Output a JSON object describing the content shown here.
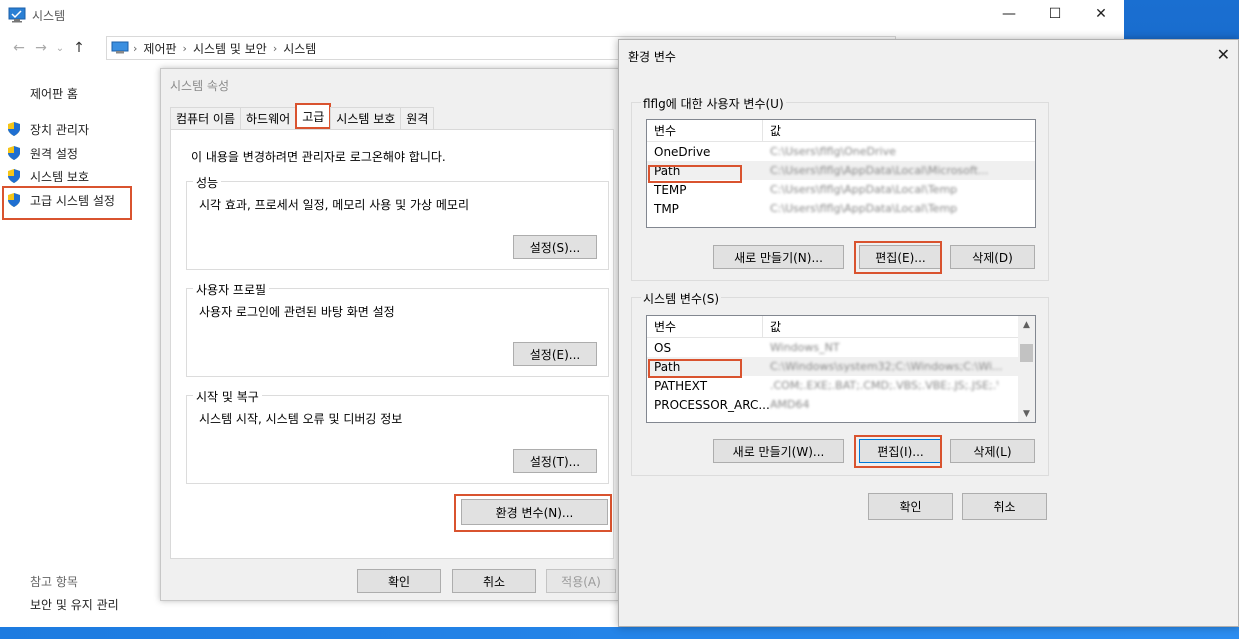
{
  "window": {
    "title": "시스템",
    "min_glyph": "—",
    "max_glyph": "☐",
    "close_glyph": "✕"
  },
  "address": {
    "back_glyph": "←",
    "forward_glyph": "→",
    "dropdown_glyph": "⌄",
    "up_glyph": "↑",
    "breadcrumbs": [
      "제어판",
      "시스템 및 보안",
      "시스템"
    ],
    "sep": "›"
  },
  "left_nav": {
    "home": "제어판 홈",
    "items": [
      "장치 관리자",
      "원격 설정",
      "시스템 보호",
      "고급 시스템 설정"
    ],
    "see_also": "참고 항목",
    "see_also_link": "보안 및 유지 관리"
  },
  "sysprop": {
    "title": "시스템 속성",
    "tabs": [
      "컴퓨터 이름",
      "하드웨어",
      "고급",
      "시스템 보호",
      "원격"
    ],
    "admin_note": "이 내용을 변경하려면 관리자로 로그온해야 합니다.",
    "groups": [
      {
        "title": "성능",
        "desc": "시각 효과, 프로세서 일정, 메모리 사용 및 가상 메모리",
        "button": "설정(S)..."
      },
      {
        "title": "사용자 프로필",
        "desc": "사용자 로그인에 관련된 바탕 화면 설정",
        "button": "설정(E)..."
      },
      {
        "title": "시작 및 복구",
        "desc": "시스템 시작, 시스템 오류 및 디버깅 정보",
        "button": "설정(T)..."
      }
    ],
    "env_button": "환경 변수(N)...",
    "ok": "확인",
    "cancel": "취소",
    "apply": "적용(A)"
  },
  "env": {
    "title": "환경 변수",
    "close_glyph": "✕",
    "user_group_title": "flflg에 대한 사용자 변수(U)",
    "col_var": "변수",
    "col_val": "값",
    "user_vars": [
      {
        "name": "OneDrive",
        "value": "C:\\Users\\flflg\\OneDrive"
      },
      {
        "name": "Path",
        "value": "C:\\Users\\flflg\\AppData\\Local\\Microsoft..."
      },
      {
        "name": "TEMP",
        "value": "C:\\Users\\flflg\\AppData\\Local\\Temp"
      },
      {
        "name": "TMP",
        "value": "C:\\Users\\flflg\\AppData\\Local\\Temp"
      }
    ],
    "user_buttons": {
      "new": "새로 만들기(N)...",
      "edit": "편집(E)...",
      "delete": "삭제(D)"
    },
    "sys_group_title": "시스템 변수(S)",
    "sys_vars": [
      {
        "name": "OS",
        "value": "Windows_NT"
      },
      {
        "name": "Path",
        "value": "C:\\Windows\\system32;C:\\Windows;C:\\Wi..."
      },
      {
        "name": "PATHEXT",
        "value": ".COM;.EXE;.BAT;.CMD;.VBS;.VBE;.JS;.JSE;.WSF;.WSH;.MSC"
      },
      {
        "name": "PROCESSOR_ARC...",
        "value": "AMD64"
      }
    ],
    "sys_buttons": {
      "new": "새로 만들기(W)...",
      "edit": "편집(I)...",
      "delete": "삭제(L)"
    },
    "ok": "확인",
    "cancel": "취소"
  },
  "colors": {
    "highlight": "#d9532f",
    "focus": "#0078d7"
  }
}
